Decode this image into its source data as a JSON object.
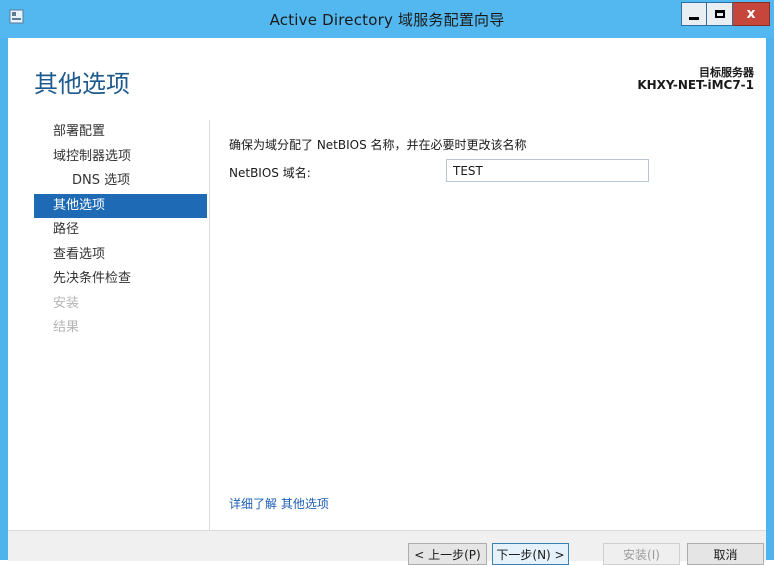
{
  "window": {
    "title": "Active Directory 域服务配置向导"
  },
  "header": {
    "page_title": "其他选项",
    "target_label": "目标服务器",
    "target_server": "KHXY-NET-iMC7-1"
  },
  "sidebar": {
    "items": [
      {
        "label": "部署配置",
        "state": "normal"
      },
      {
        "label": "域控制器选项",
        "state": "normal"
      },
      {
        "label": "DNS 选项",
        "state": "sub"
      },
      {
        "label": "其他选项",
        "state": "active"
      },
      {
        "label": "路径",
        "state": "normal"
      },
      {
        "label": "查看选项",
        "state": "normal"
      },
      {
        "label": "先决条件检查",
        "state": "normal"
      },
      {
        "label": "安装",
        "state": "disabled"
      },
      {
        "label": "结果",
        "state": "disabled"
      }
    ]
  },
  "main": {
    "instruction": "确保为域分配了 NetBIOS 名称，并在必要时更改该名称",
    "netbios_label": "NetBIOS 域名:",
    "netbios_value": "TEST",
    "more_link": "详细了解 其他选项"
  },
  "footer": {
    "prev_label": "< 上一步(P)",
    "next_label": "下一步(N) >",
    "install_label": "安装(I)",
    "cancel_label": "取消"
  },
  "colors": {
    "title_bar": "#53b8ef",
    "accent": "#1e6ab4",
    "close_button": "#c7463b",
    "page_title": "#1e5a8e"
  },
  "icons": {
    "app": "server-manager-icon",
    "minimize": "minimize-icon",
    "maximize": "maximize-icon",
    "close": "close-icon"
  }
}
